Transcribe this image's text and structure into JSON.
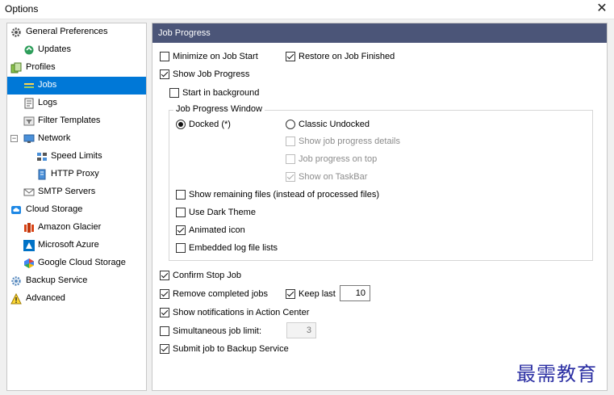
{
  "window": {
    "title": "Options"
  },
  "tree": [
    {
      "label": "General Preferences",
      "icon": "gear-icon",
      "expander": ""
    },
    {
      "label": "Updates",
      "icon": "update-icon",
      "expander": ""
    },
    {
      "label": "Profiles",
      "icon": "profiles-icon",
      "expander": ""
    },
    {
      "label": "Jobs",
      "icon": "jobs-icon",
      "expander": ""
    },
    {
      "label": "Logs",
      "icon": "logs-icon",
      "expander": ""
    },
    {
      "label": "Filter Templates",
      "icon": "filter-icon",
      "expander": ""
    },
    {
      "label": "Network",
      "icon": "network-icon",
      "expander": "−"
    },
    {
      "label": "Speed Limits",
      "icon": "speed-icon",
      "expander": ""
    },
    {
      "label": "HTTP Proxy",
      "icon": "proxy-icon",
      "expander": ""
    },
    {
      "label": "SMTP Servers",
      "icon": "mail-icon",
      "expander": ""
    },
    {
      "label": "Cloud Storage",
      "icon": "cloud-icon",
      "expander": ""
    },
    {
      "label": "Amazon Glacier",
      "icon": "glacier-icon",
      "expander": ""
    },
    {
      "label": "Microsoft Azure",
      "icon": "azure-icon",
      "expander": ""
    },
    {
      "label": "Google Cloud Storage",
      "icon": "gcloud-icon",
      "expander": ""
    },
    {
      "label": "Backup Service",
      "icon": "backup-service-icon",
      "expander": ""
    },
    {
      "label": "Advanced",
      "icon": "warning-icon",
      "expander": ""
    }
  ],
  "selected_tree_item": "Jobs",
  "panel": {
    "title": "Job Progress",
    "group_title": "Job Progress Window",
    "options": {
      "minimize_on_start": {
        "label": "Minimize on Job Start",
        "checked": false
      },
      "restore_on_finished": {
        "label": "Restore on Job Finished",
        "checked": true
      },
      "show_job_progress": {
        "label": "Show Job Progress",
        "checked": true
      },
      "start_in_background": {
        "label": "Start in background",
        "checked": false
      },
      "docked": {
        "label": "Docked (*)",
        "selected": true
      },
      "classic_undocked": {
        "label": "Classic Undocked",
        "selected": false
      },
      "show_details": {
        "label": "Show job progress details",
        "checked": false,
        "disabled": true
      },
      "progress_on_top": {
        "label": "Job progress on top",
        "checked": false,
        "disabled": true
      },
      "show_on_taskbar": {
        "label": "Show on TaskBar",
        "checked": true,
        "disabled": true
      },
      "show_remaining": {
        "label": "Show remaining files (instead of processed files)",
        "checked": false
      },
      "dark_theme": {
        "label": "Use Dark Theme",
        "checked": false
      },
      "animated_icon": {
        "label": "Animated icon",
        "checked": true
      },
      "embedded_log": {
        "label": "Embedded log file lists",
        "checked": false
      },
      "confirm_stop": {
        "label": "Confirm Stop Job",
        "checked": true
      },
      "remove_completed": {
        "label": "Remove completed jobs",
        "checked": true
      },
      "keep_last": {
        "label": "Keep last",
        "checked": true,
        "value": "10"
      },
      "show_notifications": {
        "label": "Show notifications in Action Center",
        "checked": true
      },
      "simultaneous_limit": {
        "label": "Simultaneous job limit:",
        "checked": false,
        "value": "3"
      },
      "submit_backup": {
        "label": "Submit job to Backup Service",
        "checked": true
      }
    }
  },
  "watermark": "最需教育",
  "colors": {
    "selection": "#0078d7",
    "header": "#4b5578"
  }
}
